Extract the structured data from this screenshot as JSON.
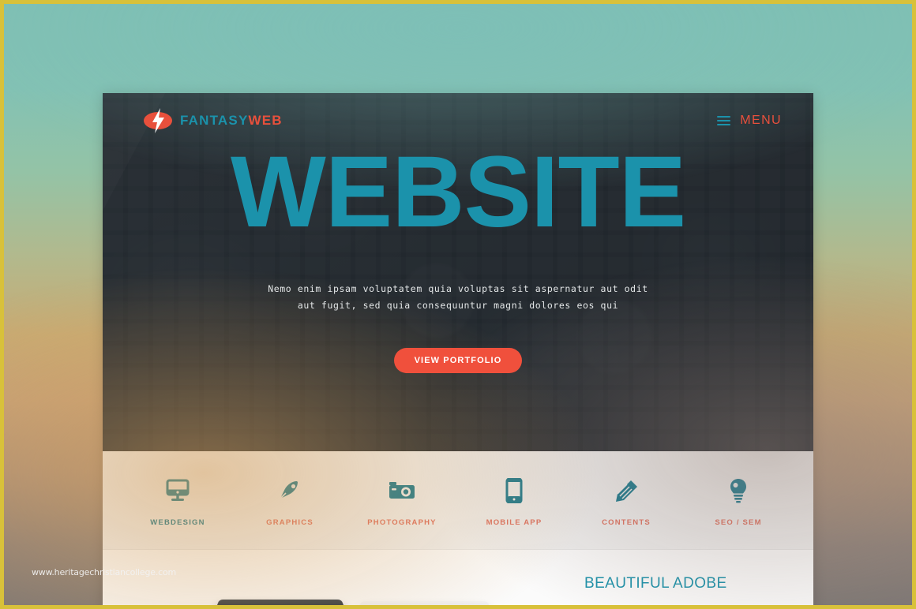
{
  "frame": {
    "border_color": "#d8c13a",
    "background_description": "teal-to-tan vertical gradient"
  },
  "watermark": {
    "text": "www.heritagechristiancollege.com"
  },
  "theme": {
    "teal": "#1b92ab",
    "teal_dark": "#13788e",
    "coral": "#e8503c",
    "button_coral": "#f0503c",
    "hero_bg": "#2b3238",
    "services_bg": "#f0f0f0"
  },
  "header": {
    "logo_icon": "lightning-bolt-icon",
    "brand_first": "FANTASY",
    "brand_second": "WEB",
    "menu_icon": "hamburger-icon",
    "menu_label": "MENU"
  },
  "hero": {
    "headline": "WEBSITE",
    "tagline_line1": "Nemo enim ipsam voluptatem quia voluptas sit aspernatur aut odit",
    "tagline_line2": "aut fugit, sed quia consequuntur magni dolores eos qui",
    "cta_label": "VIEW PORTFOLIO"
  },
  "services": [
    {
      "icon": "monitor-icon",
      "label": "WEBDESIGN",
      "label_color": "#13788e"
    },
    {
      "icon": "pen-nib-icon",
      "label": "GRAPHICS",
      "label_color": "#e0705f"
    },
    {
      "icon": "camera-icon",
      "label": "PHOTOGRAPHY",
      "label_color": "#e0705f"
    },
    {
      "icon": "mobile-icon",
      "label": "MOBILE APP",
      "label_color": "#e0705f"
    },
    {
      "icon": "pencil-icon",
      "label": "CONTENTS",
      "label_color": "#e0705f"
    },
    {
      "icon": "lightbulb-icon",
      "label": "SEO / SEM",
      "label_color": "#e0705f"
    }
  ],
  "bottom": {
    "title": "BEAUTIFUL ADOBE"
  }
}
